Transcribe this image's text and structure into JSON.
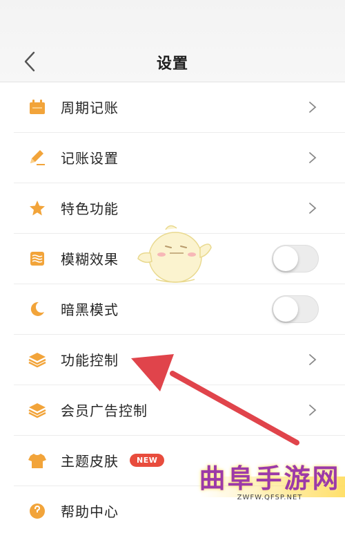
{
  "header": {
    "title": "设置",
    "back_icon": "chevron-left-icon"
  },
  "items": [
    {
      "label": "周期记账",
      "icon": "calendar-icon",
      "control": "chevron"
    },
    {
      "label": "记账设置",
      "icon": "pen-icon",
      "control": "chevron"
    },
    {
      "label": "特色功能",
      "icon": "star-icon",
      "control": "chevron"
    },
    {
      "label": "模糊效果",
      "icon": "blur-icon",
      "control": "toggle",
      "toggle_on": false
    },
    {
      "label": "暗黑模式",
      "icon": "moon-icon",
      "control": "toggle",
      "toggle_on": false
    },
    {
      "label": "功能控制",
      "icon": "layers-icon",
      "control": "chevron"
    },
    {
      "label": "会员广告控制",
      "icon": "layers-icon",
      "control": "chevron"
    },
    {
      "label": "主题皮肤",
      "icon": "tshirt-icon",
      "control": "badge",
      "badge": "NEW"
    },
    {
      "label": "帮助中心",
      "icon": "help-icon",
      "control": "none"
    }
  ],
  "watermark": {
    "main": "曲阜手游网",
    "sub": "ZWFW.QFSP.NET"
  },
  "colors": {
    "accent": "#f2a43a",
    "arrow": "#e0444b",
    "badge": "#e84c3d"
  }
}
